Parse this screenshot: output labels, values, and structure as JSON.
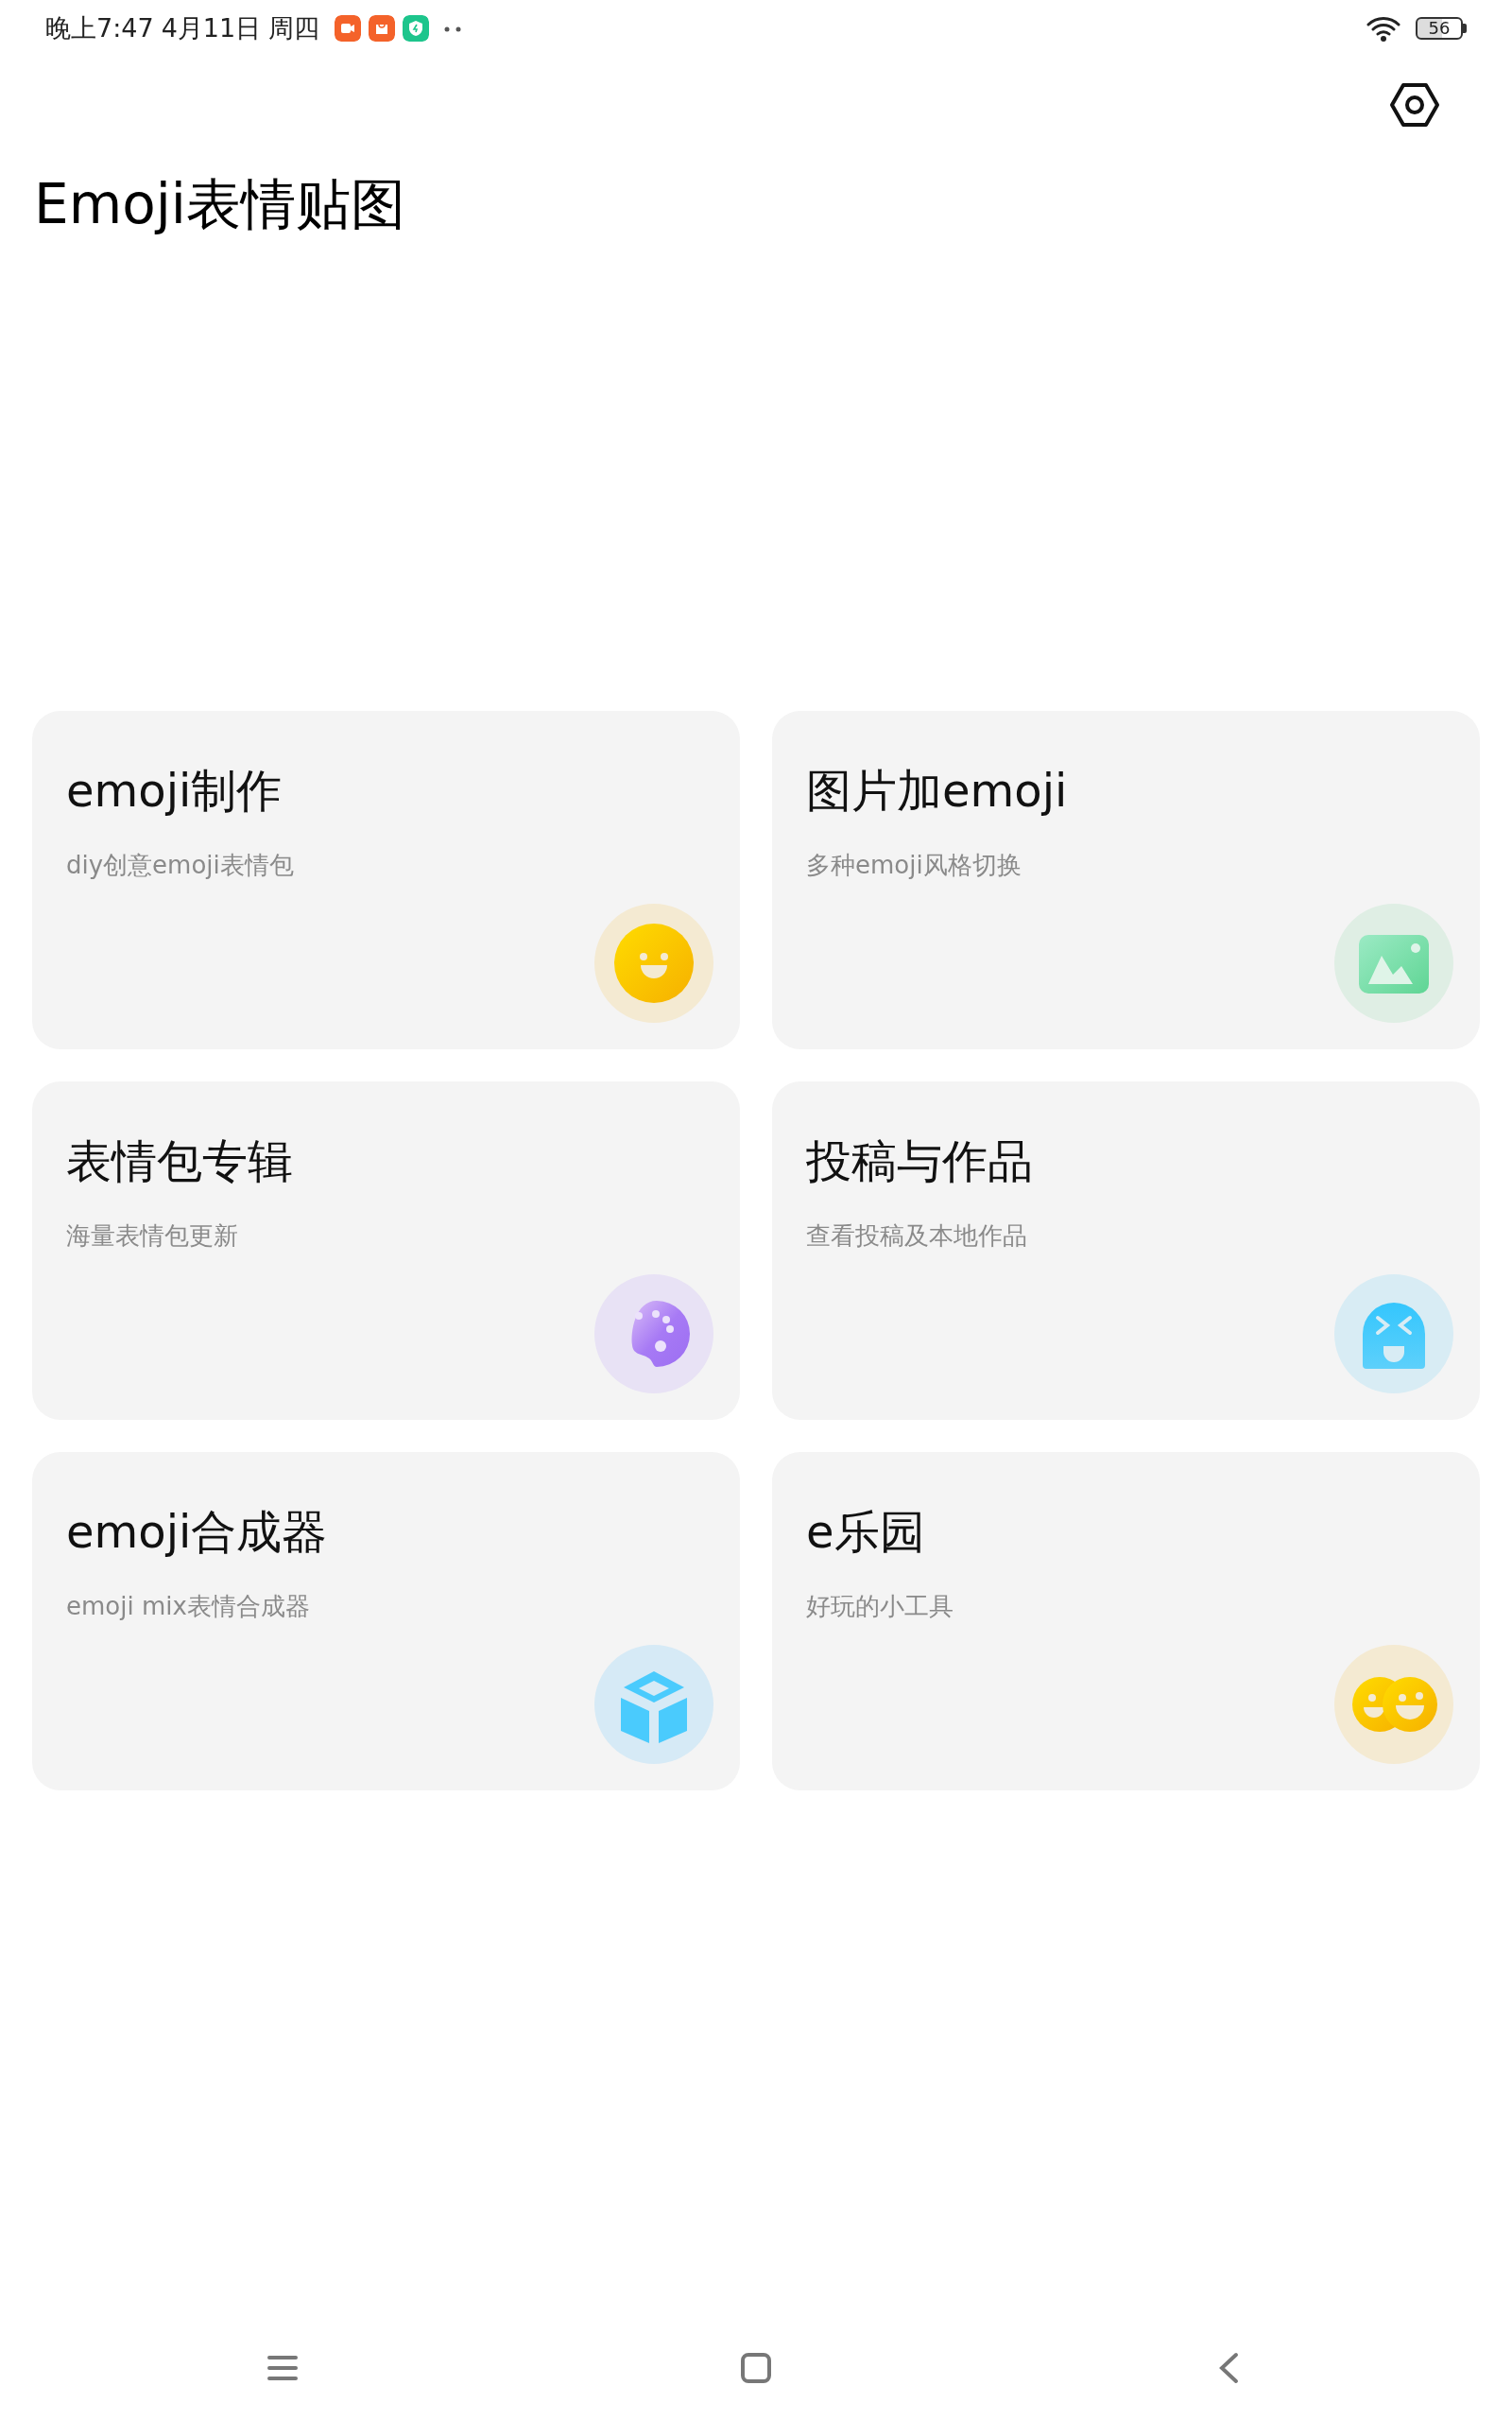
{
  "status_bar": {
    "time": "晚上7:47",
    "date": "4月11日",
    "weekday": "周四",
    "battery": "56"
  },
  "app": {
    "title": "Emoji表情贴图"
  },
  "cards": [
    {
      "title": "emoji制作",
      "subtitle": "diy创意emoji表情包"
    },
    {
      "title": "图片加emoji",
      "subtitle": "多种emoji风格切换"
    },
    {
      "title": "表情包专辑",
      "subtitle": "海量表情包更新"
    },
    {
      "title": "投稿与作品",
      "subtitle": "查看投稿及本地作品"
    },
    {
      "title": "emoji合成器",
      "subtitle": "emoji mix表情合成器"
    },
    {
      "title": "e乐园",
      "subtitle": "好玩的小工具"
    }
  ]
}
